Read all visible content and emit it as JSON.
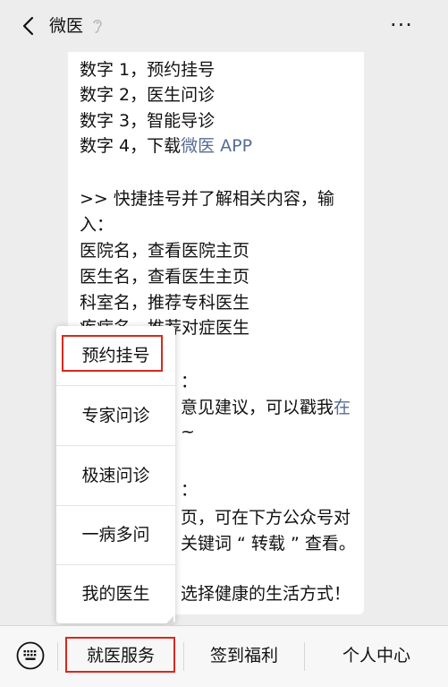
{
  "navbar": {
    "title": "微医",
    "back_icon": "chevron-left-icon",
    "ear_icon": "ear-icon",
    "more_label": "···"
  },
  "message": {
    "lines": [
      "数字 1，预约挂号",
      "数字 2，医生问诊",
      "数字 3，智能导诊",
      "数字 4，下载",
      ">> 快捷挂号并了解相关内容，输",
      "入：",
      "医院名，查看医院主页",
      "医生名，查看医生主页",
      "科室名，推荐专科医生",
      "疾病名，推荐对症医生",
      "：",
      "意见建议，可以戳我",
      "~",
      "：",
      "页，可在下方公众号对",
      "关键词 “ 转载 ” 查看。",
      "选择健康的生活方式！"
    ],
    "link_app": "微医 APP",
    "link_zai": "在"
  },
  "popup_menu": {
    "items": [
      "预约挂号",
      "专家问诊",
      "极速问诊",
      "一病多问",
      "我的医生"
    ],
    "highlighted_index": 0
  },
  "bottom_bar": {
    "keyboard_icon": "keyboard-icon",
    "tabs": [
      "就医服务",
      "签到福利",
      "个人中心"
    ],
    "highlighted_index": 0
  },
  "colors": {
    "background": "#ededed",
    "bubble": "#ffffff",
    "link": "#576b95",
    "highlight_box": "#d9281e"
  }
}
